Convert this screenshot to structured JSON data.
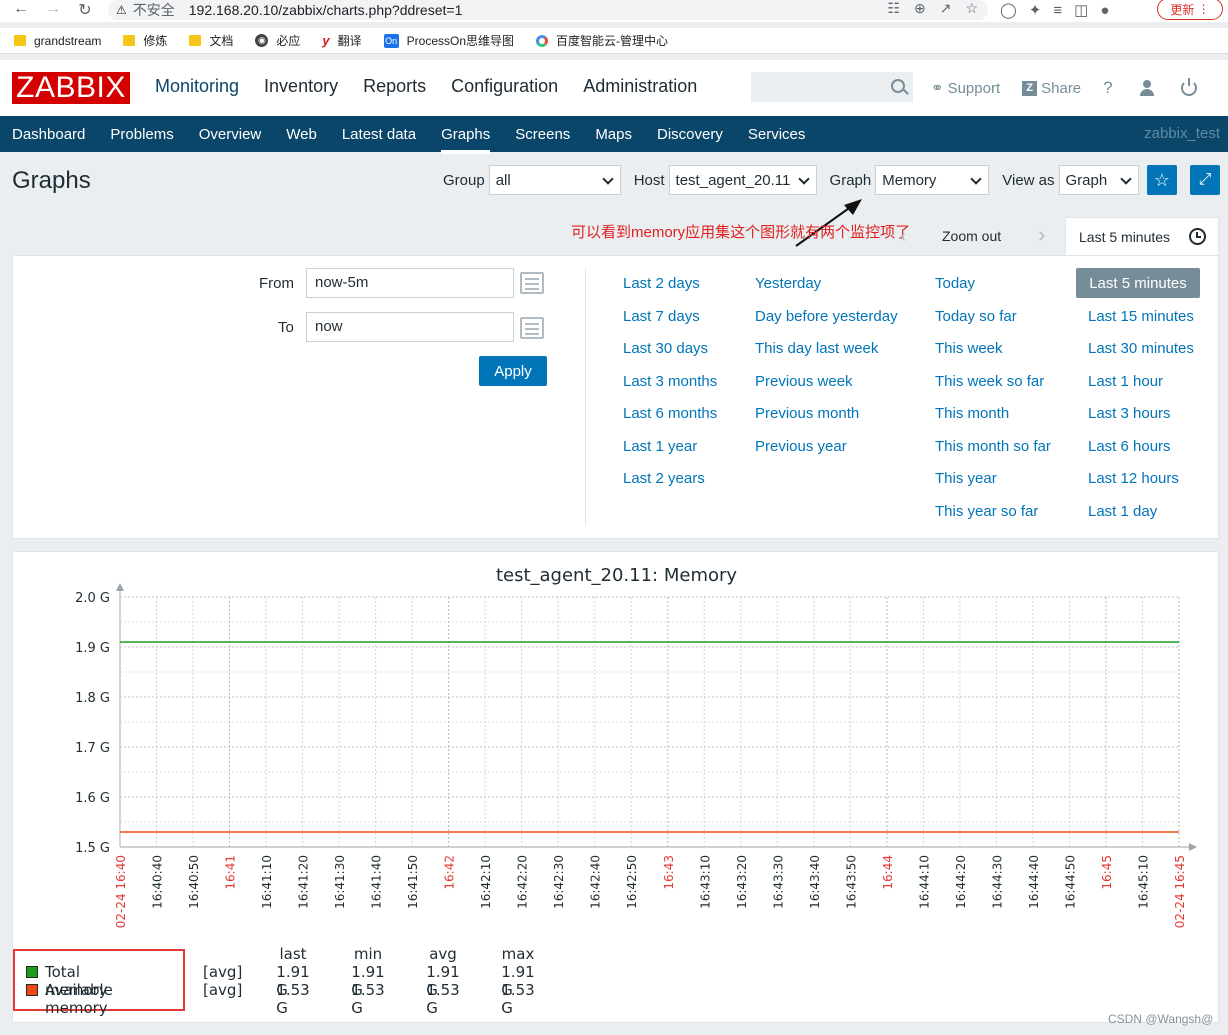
{
  "browser": {
    "insecure_label": "不安全",
    "url": "192.168.20.10/zabbix/charts.php?ddreset=1",
    "update_label": "更新",
    "bookmarks": [
      "grandstream",
      "修炼",
      "文档",
      "必应",
      "翻译",
      "ProcessOn思维导图",
      "百度智能云-管理中心"
    ]
  },
  "header": {
    "logo": "ZABBIX",
    "menu": [
      "Monitoring",
      "Inventory",
      "Reports",
      "Configuration",
      "Administration"
    ],
    "support": "Support",
    "share": "Share",
    "help": "?"
  },
  "submenu": {
    "items": [
      "Dashboard",
      "Problems",
      "Overview",
      "Web",
      "Latest data",
      "Graphs",
      "Screens",
      "Maps",
      "Discovery",
      "Services"
    ],
    "active": "Graphs",
    "user": "zabbix_test"
  },
  "page": {
    "title": "Graphs",
    "group_label": "Group",
    "group_value": "all",
    "host_label": "Host",
    "host_value": "test_agent_20.11",
    "graph_label": "Graph",
    "graph_value": "Memory",
    "view_label": "View as",
    "view_value": "Graph"
  },
  "annotation": "可以看到memory应用集这个图形就有两个监控项了",
  "time": {
    "zoom_out": "Zoom out",
    "active_tab": "Last 5 minutes",
    "from_label": "From",
    "from_value": "now-5m",
    "to_label": "To",
    "to_value": "now",
    "apply": "Apply",
    "quick_col1": [
      "Last 2 days",
      "Last 7 days",
      "Last 30 days",
      "Last 3 months",
      "Last 6 months",
      "Last 1 year",
      "Last 2 years"
    ],
    "quick_col2": [
      "Yesterday",
      "Day before yesterday",
      "This day last week",
      "Previous week",
      "Previous month",
      "Previous year"
    ],
    "quick_col3": [
      "Today",
      "Today so far",
      "This week",
      "This week so far",
      "This month",
      "This month so far",
      "This year",
      "This year so far"
    ],
    "quick_col4": [
      "Last 5 minutes",
      "Last 15 minutes",
      "Last 30 minutes",
      "Last 1 hour",
      "Last 3 hours",
      "Last 6 hours",
      "Last 12 hours",
      "Last 1 day"
    ],
    "quick_selected": "Last 5 minutes"
  },
  "chart_data": {
    "type": "line",
    "title": "test_agent_20.11: Memory",
    "y_ticks": [
      "2.0 G",
      "1.9 G",
      "1.8 G",
      "1.7 G",
      "1.6 G",
      "1.5 G"
    ],
    "ylim": [
      1.5,
      2.0
    ],
    "x_ticks": [
      {
        "label": "02-24 16:40",
        "red": true
      },
      {
        "label": "16:40:40",
        "red": false
      },
      {
        "label": "16:40:50",
        "red": false
      },
      {
        "label": "16:41",
        "red": true
      },
      {
        "label": "16:41:10",
        "red": false
      },
      {
        "label": "16:41:20",
        "red": false
      },
      {
        "label": "16:41:30",
        "red": false
      },
      {
        "label": "16:41:40",
        "red": false
      },
      {
        "label": "16:41:50",
        "red": false
      },
      {
        "label": "16:42",
        "red": true
      },
      {
        "label": "16:42:10",
        "red": false
      },
      {
        "label": "16:42:20",
        "red": false
      },
      {
        "label": "16:42:30",
        "red": false
      },
      {
        "label": "16:42:40",
        "red": false
      },
      {
        "label": "16:42:50",
        "red": false
      },
      {
        "label": "16:43",
        "red": true
      },
      {
        "label": "16:43:10",
        "red": false
      },
      {
        "label": "16:43:20",
        "red": false
      },
      {
        "label": "16:43:30",
        "red": false
      },
      {
        "label": "16:43:40",
        "red": false
      },
      {
        "label": "16:43:50",
        "red": false
      },
      {
        "label": "16:44",
        "red": true
      },
      {
        "label": "16:44:10",
        "red": false
      },
      {
        "label": "16:44:20",
        "red": false
      },
      {
        "label": "16:44:30",
        "red": false
      },
      {
        "label": "16:44:40",
        "red": false
      },
      {
        "label": "16:44:50",
        "red": false
      },
      {
        "label": "16:45",
        "red": true
      },
      {
        "label": "16:45:10",
        "red": false
      },
      {
        "label": "02-24 16:45",
        "red": true
      }
    ],
    "series": [
      {
        "name": "Total memory",
        "color": "#1a9e1a",
        "value": 1.91,
        "last": "1.91 G",
        "min": "1.91 G",
        "avg": "1.91 G",
        "max": "1.91 G",
        "func": "[avg]"
      },
      {
        "name": "Available memory",
        "color": "#f2480d",
        "value": 1.53,
        "last": "1.53 G",
        "min": "1.53 G",
        "avg": "1.53 G",
        "max": "1.53 G",
        "func": "[avg]"
      }
    ],
    "legend_headers": [
      "last",
      "min",
      "avg",
      "max"
    ],
    "grid": true
  },
  "watermark": "CSDN @Wangsh@"
}
